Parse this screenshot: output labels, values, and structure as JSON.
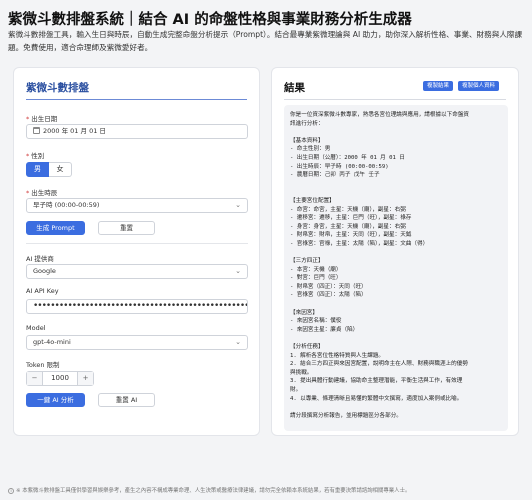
{
  "header": {
    "title": "紫微斗數排盤系統｜結合 AI 的命盤性格與事業財務分析生成器",
    "description": "紫微斗數排盤工具，輸入生日與時辰，自動生成完整命盤分析提示（Prompt）。結合最專業紫微理論與 AI 助力，助你深入解析性格、事業、財務與人際課題。免費使用，適合命理師及紫微愛好者。"
  },
  "form": {
    "title": "紫微斗數排盤",
    "birth_date_label": "出生日期",
    "birth_date_value": "2000 年 01 月 01 日",
    "gender_label": "性別",
    "gender_options": [
      "男",
      "女"
    ],
    "birth_time_label": "出生時辰",
    "birth_time_value": "早子時 (00:00-00:59)",
    "generate_prompt_label": "生成 Prompt",
    "reset_label": "重置",
    "ai_provider_label": "AI 提供商",
    "ai_provider_value": "Google",
    "api_key_label": "AI API Key",
    "api_key_value": "••••••••••••••••••••••••••••••••••••••••••••••••••••••",
    "model_label": "Model",
    "model_value": "gpt-4o-mini",
    "token_label": "Token 限制",
    "token_value": "1000",
    "minus": "−",
    "plus": "+",
    "analyze_label": "一鍵 AI 分析",
    "reset_ai_label": "重置 AI",
    "required_mark": "*",
    "chevron": "⌄"
  },
  "result": {
    "title": "結果",
    "copy_result_label": "複製結果",
    "copy_personal_label": "複製個人資料",
    "lines": [
      "你是一位資深紫微斗數專家，熟悉各宮位理論與應用，請根據以下命盤資",
      "訊進行分析：",
      "",
      "【基本資料】",
      "- 命主性別：男",
      "- 出生日期（公曆）：2000 年 01 月 01 日",
      "- 出生時辰：早子時 (00:00-00:59)",
      "- 農曆日期：己卯 丙子 戊午 壬子",
      "",
      "",
      "【主要宮位配置】",
      "- 命宮：命宮，主星：天機（廟），副星：右弼",
      "- 遷移宮：遷移，主星：巨門（旺），副星：祿存",
      "- 身宮：身宮，主星：天機（廟），副星：右弼",
      "- 財帛宮：財帛，主星：天同（旺），副星：天鉞",
      "- 官祿宮：官祿，主星：太陽（陷），副星：文曲（得）",
      "",
      "【三方四正】",
      "- 本宮：天機（廟）",
      "- 對宮：巨門（旺）",
      "- 財帛宮（四正）：天同（旺）",
      "- 官祿宮（四正）：太陽（陷）",
      "",
      "【來因宮】",
      "- 來因宮名稱：僕役",
      "- 來因宮主星：廉貞（陷）",
      "",
      "【分析任務】",
      "1. 解析各宮位性格特質與人生課題。",
      "2. 結合三方四正與來因宮配置，說明命主在人際、財務與職涯上的優勢",
      "與挑戰。",
      "3. 提出具體行動建議，協助命主整理潛能，平衡生活與工作，有效理",
      "財。",
      "4. 以專業、條理清晰且易懂的繁體中文撰寫，適度加入案例或比喻。",
      "",
      "請分段撰寫分析報告，並用標題區分各部分。"
    ]
  },
  "footer": {
    "text": "※ 本紫微斗數排盤工具僅供學習與娛樂參考，產生之內容不構成專業命理、人生決策或醫療法律建議，請勿完全依賴本系統結果，若有重要決策請諮詢相關專業人士。",
    "icon_glyph": "i"
  }
}
